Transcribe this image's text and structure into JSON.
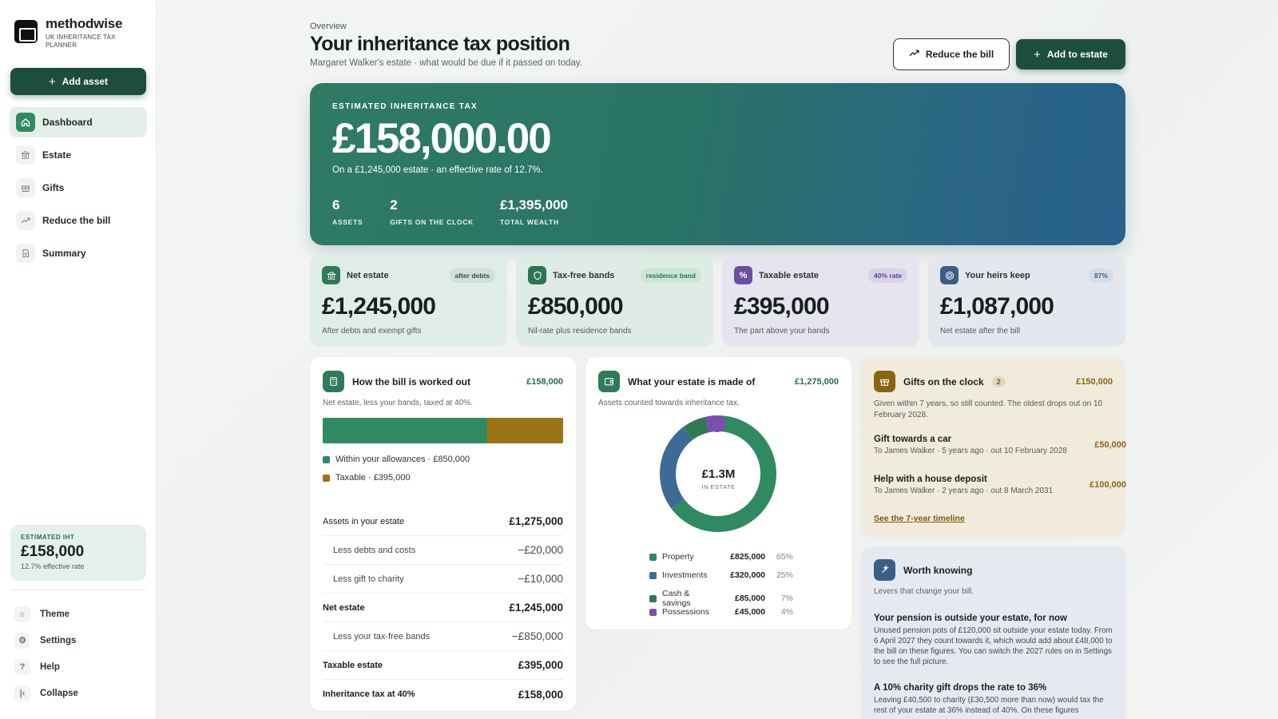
{
  "brand": {
    "name": "methodwise",
    "sub": "UK INHERITANCE TAX PLANNER"
  },
  "sidebar": {
    "add_asset": "Add asset",
    "items": [
      {
        "label": "Dashboard",
        "icon": "home-icon"
      },
      {
        "label": "Estate",
        "icon": "bank-icon"
      },
      {
        "label": "Gifts",
        "icon": "gift-icon"
      },
      {
        "label": "Reduce the bill",
        "icon": "trend-icon"
      },
      {
        "label": "Summary",
        "icon": "document-icon"
      }
    ],
    "iht": {
      "label": "ESTIMATED IHT",
      "value": "£158,000",
      "sub": "12.7% effective rate"
    },
    "bottom": [
      {
        "label": "Theme"
      },
      {
        "label": "Settings"
      },
      {
        "label": "Help"
      },
      {
        "label": "Collapse"
      }
    ]
  },
  "header": {
    "overline": "Overview",
    "title": "Your inheritance tax position",
    "subtitle": "Margaret Walker's estate · what would be due if it passed on today.",
    "reduce_btn": "Reduce the bill",
    "add_btn": "Add to estate"
  },
  "hero": {
    "label": "ESTIMATED INHERITANCE TAX",
    "value": "£158,000.00",
    "desc": "On a £1,245,000 estate · an effective rate of 12.7%.",
    "stats": [
      {
        "n": "6",
        "t": "ASSETS"
      },
      {
        "n": "2",
        "t": "GIFTS ON THE CLOCK"
      },
      {
        "n": "£1,395,000",
        "t": "TOTAL WEALTH"
      }
    ]
  },
  "stats": [
    {
      "name": "Net estate",
      "badge": "after debts",
      "value": "£1,245,000",
      "sub": "After debts and exempt gifts"
    },
    {
      "name": "Tax-free bands",
      "badge": "residence band",
      "value": "£850,000",
      "sub": "Nil-rate plus residence bands"
    },
    {
      "name": "Taxable estate",
      "badge": "40% rate",
      "value": "£395,000",
      "sub": "The part above your bands"
    },
    {
      "name": "Your heirs keep",
      "badge": "87%",
      "value": "£1,087,000",
      "sub": "Net estate after the bill"
    }
  ],
  "bill": {
    "title": "How the bill is worked out",
    "total": "£158,000",
    "sub": "Net estate, less your bands, taxed at 40%.",
    "bar": {
      "allowance": 850000,
      "taxable": 395000
    },
    "legend": [
      {
        "label": "Within your allowances · £850,000",
        "color": "#2f8a62"
      },
      {
        "label": "Taxable · £395,000",
        "color": "#9a7415"
      }
    ],
    "rows": [
      {
        "label": "Assets in your estate",
        "value": "£1,275,000",
        "indent": false,
        "bold": false
      },
      {
        "label": "Less debts and costs",
        "value": "−£20,000",
        "indent": true,
        "bold": false
      },
      {
        "label": "Less gift to charity",
        "value": "−£10,000",
        "indent": true,
        "bold": false
      },
      {
        "label": "Net estate",
        "value": "£1,245,000",
        "indent": false,
        "bold": true
      },
      {
        "label": "Less your tax-free bands",
        "value": "−£850,000",
        "indent": true,
        "bold": false
      },
      {
        "label": "Taxable estate",
        "value": "£395,000",
        "indent": false,
        "bold": true
      },
      {
        "label": "Inheritance tax at 40%",
        "value": "£158,000",
        "indent": false,
        "bold": true
      }
    ]
  },
  "estate": {
    "title": "What your estate is made of",
    "total": "£1,275,000",
    "sub": "Assets counted towards inheritance tax.",
    "center_value": "£1.3M",
    "center_label": "IN ESTATE",
    "items": [
      {
        "name": "Property",
        "value": "£825,000",
        "pct": "65%",
        "color": "#2f8a62"
      },
      {
        "name": "Investments",
        "value": "£320,000",
        "pct": "25%",
        "color": "#3d6a97"
      },
      {
        "name": "Cash & savings",
        "value": "£85,000",
        "pct": "7%",
        "color": "#2f7a50"
      },
      {
        "name": "Possessions",
        "value": "£45,000",
        "pct": "4%",
        "color": "#7a4fb0"
      }
    ]
  },
  "gifts": {
    "title": "Gifts on the clock",
    "count": "2",
    "total": "£150,000",
    "sub": "Given within 7 years, so still counted. The oldest drops out on 10 February 2028.",
    "items": [
      {
        "name": "Gift towards a car",
        "sub": "To James Walker · 5 years ago · out 10 February 2028",
        "value": "£50,000"
      },
      {
        "name": "Help with a house deposit",
        "sub": "To James Walker · 2 years ago · out 8 March 2031",
        "value": "£100,000"
      }
    ],
    "link": "See the 7-year timeline"
  },
  "worth": {
    "title": "Worth knowing",
    "sub": "Levers that change your bill.",
    "items": [
      {
        "title": "Your pension is outside your estate, for now",
        "body": "Unused pension pots of £120,000 sit outside your estate today. From 6 April 2027 they count towards it, which would add about £48,000 to the bill on these figures. You can switch the 2027 rules on in Settings to see the full picture."
      },
      {
        "title": "A 10% charity gift drops the rate to 36%",
        "body": "Leaving £40,500 to charity (£30,500 more than now) would tax the rest of your estate at 36% instead of 40%. On these figures"
      }
    ]
  }
}
